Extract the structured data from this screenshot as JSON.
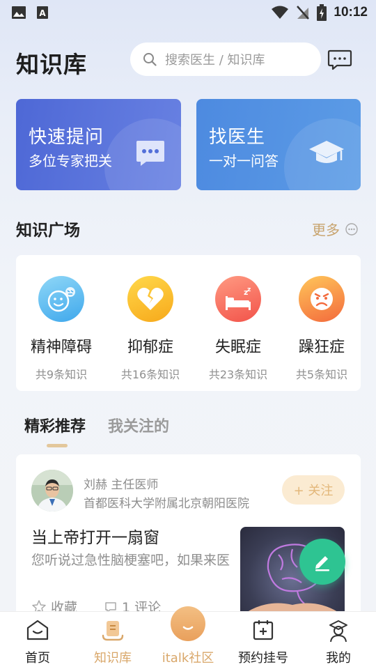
{
  "status_bar": {
    "time": "10:12"
  },
  "header": {
    "title": "知识库",
    "search_placeholder": "搜索医生 / 知识库"
  },
  "hero": [
    {
      "title": "快速提问",
      "subtitle": "多位专家把关"
    },
    {
      "title": "找医生",
      "subtitle": "一对一问答"
    }
  ],
  "plaza": {
    "title": "知识广场",
    "more": "更多",
    "categories": [
      {
        "name": "精神障碍",
        "count": "共9条知识"
      },
      {
        "name": "抑郁症",
        "count": "共16条知识"
      },
      {
        "name": "失眠症",
        "count": "共23条知识"
      },
      {
        "name": "躁狂症",
        "count": "共5条知识"
      }
    ]
  },
  "tabs": {
    "active": "精彩推荐",
    "inactive": "我关注的"
  },
  "feed": {
    "doctor": "刘赫 主任医师",
    "hospital": "首都医科大学附属北京朝阳医院",
    "follow": "+ 关注",
    "title": "当上帝打开一扇窗",
    "excerpt": "您听说过急性脑梗塞吧，如果来医",
    "favorite": "收藏",
    "comments": "1 评论"
  },
  "nav": [
    {
      "label": "首页"
    },
    {
      "label": "知识库"
    },
    {
      "label": "italk社区"
    },
    {
      "label": "预约挂号"
    },
    {
      "label": "我的"
    }
  ],
  "colors": {
    "accent": "#d9a76a",
    "ask_card": "#5470d9",
    "doctor_card": "#5291e3",
    "fab": "#2ec492"
  }
}
